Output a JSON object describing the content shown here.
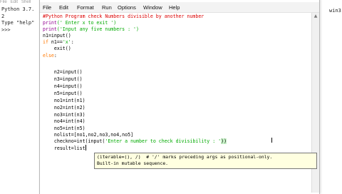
{
  "shell": {
    "menu": [
      "File",
      "Edit",
      "Shell"
    ],
    "lines": [
      "Python 3.7.",
      "2",
      "Type \"help\"",
      ">>>"
    ],
    "right_edge_text": "win3"
  },
  "editor": {
    "menu": [
      "File",
      "Edit",
      "Format",
      "Run",
      "Options",
      "Window",
      "Help"
    ],
    "code": {
      "l1": "#Python Program check Numbers divisible by another number",
      "l2_fn": "print",
      "l2_str": "(' Enter x to exit ')",
      "l3_fn": "print",
      "l3_str": "('Input any five numbers : ')",
      "l4": "n1=input()",
      "l5_kw": "if",
      "l5_a": " n1==",
      "l5_str": "'x'",
      "l5_b": ":",
      "l6": "    exit()",
      "l7_kw": "else",
      "l7_b": ":",
      "l8": "    n2=input()",
      "l9": "    n3=input()",
      "l10": "    n4=input()",
      "l11": "    n5=input()",
      "l12": "    no1=int(n1)",
      "l13": "    no2=int(n2)",
      "l14": "    no3=int(n3)",
      "l15": "    no4=int(n4)",
      "l16": "    no5=int(n5)",
      "l17": "    nolist=[no1,no2,no3,no4,no5]",
      "l18_a": "    checkno=int(input(",
      "l18_str": "'Enter a number to check divisibility : '",
      "l18_hl": "))",
      "l19": "    result=list"
    },
    "calltip": {
      "line1": "(iterable=(), /)  # '/' marks preceding args as positional-only.",
      "line2": "Built-in mutable sequence."
    }
  }
}
